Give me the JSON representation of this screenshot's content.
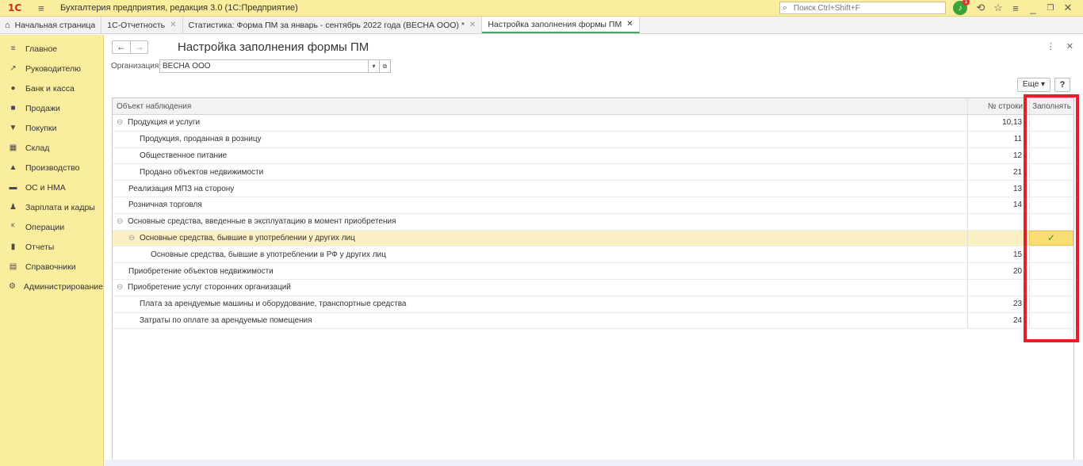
{
  "titlebar": {
    "logo": "1С",
    "title": "Бухгалтерия предприятия, редакция 3.0  (1С:Предприятие)",
    "search_placeholder": "Поиск Ctrl+Shift+F",
    "notifications_count": "1"
  },
  "tabs": [
    {
      "label": "Начальная страница"
    },
    {
      "label": "1С-Отчетность"
    },
    {
      "label": "Статистика: Форма ПМ за январь - сентябрь 2022 года (ВЕСНА ООО) *"
    },
    {
      "label": "Настройка заполнения формы ПМ"
    }
  ],
  "sidebar": {
    "items": [
      {
        "label": "Главное",
        "icon": "≡"
      },
      {
        "label": "Руководителю",
        "icon": "↗"
      },
      {
        "label": "Банк и касса",
        "icon": "●"
      },
      {
        "label": "Продажи",
        "icon": "■"
      },
      {
        "label": "Покупки",
        "icon": "▼"
      },
      {
        "label": "Склад",
        "icon": "▦"
      },
      {
        "label": "Производство",
        "icon": "▲"
      },
      {
        "label": "ОС и НМА",
        "icon": "▬"
      },
      {
        "label": "Зарплата и кадры",
        "icon": "♟"
      },
      {
        "label": "Операции",
        "icon": "ᴷ"
      },
      {
        "label": "Отчеты",
        "icon": "▮"
      },
      {
        "label": "Справочники",
        "icon": "▤"
      },
      {
        "label": "Администрирование",
        "icon": "⚙"
      }
    ]
  },
  "form": {
    "title": "Настройка заполнения формы ПМ",
    "org_label": "Организация:",
    "org_value": "ВЕСНА ООО",
    "more_button": "Еще ▾",
    "help_button": "?"
  },
  "table": {
    "headers": [
      "Объект наблюдения",
      "№ строки",
      "Заполнять"
    ],
    "rows": [
      {
        "name": "Продукция и услуги",
        "line": "10,13",
        "indent": 0,
        "toggle": "⊖",
        "fill": ""
      },
      {
        "name": "Продукция, проданная в розницу",
        "line": "11",
        "indent": 2,
        "toggle": "",
        "fill": ""
      },
      {
        "name": "Общественное питание",
        "line": "12",
        "indent": 2,
        "toggle": "",
        "fill": ""
      },
      {
        "name": "Продано объектов недвижимости",
        "line": "21",
        "indent": 2,
        "toggle": "",
        "fill": ""
      },
      {
        "name": "Реализация МПЗ на сторону",
        "line": "13",
        "indent": 1,
        "toggle": "",
        "fill": ""
      },
      {
        "name": "Розничная торговля",
        "line": "14",
        "indent": 1,
        "toggle": "",
        "fill": ""
      },
      {
        "name": "Основные средства, введенные в эксплуатацию в момент приобретения",
        "line": "",
        "indent": 0,
        "toggle": "⊖",
        "fill": ""
      },
      {
        "name": "Основные средства, бывшие в употреблении у других лиц",
        "line": "",
        "indent": 1,
        "toggle": "⊖",
        "fill": "✓",
        "selected": true
      },
      {
        "name": "Основные средства, бывшие в употреблении в РФ у других лиц",
        "line": "15",
        "indent": 3,
        "toggle": "",
        "fill": ""
      },
      {
        "name": "Приобретение объектов недвижимости",
        "line": "20",
        "indent": 1,
        "toggle": "",
        "fill": ""
      },
      {
        "name": "Приобретение услуг сторонних организаций",
        "line": "",
        "indent": 0,
        "toggle": "⊖",
        "fill": ""
      },
      {
        "name": "Плата за арендуемые машины и оборудование, транспортные средства",
        "line": "23",
        "indent": 2,
        "toggle": "",
        "fill": ""
      },
      {
        "name": "Затраты по оплате за арендуемые помещения",
        "line": "24",
        "indent": 2,
        "toggle": "",
        "fill": ""
      }
    ]
  },
  "colors": {
    "accent_yellow": "#fbed9e",
    "annotation_red": "#e3202a",
    "check_green": "#2f8f3a"
  }
}
